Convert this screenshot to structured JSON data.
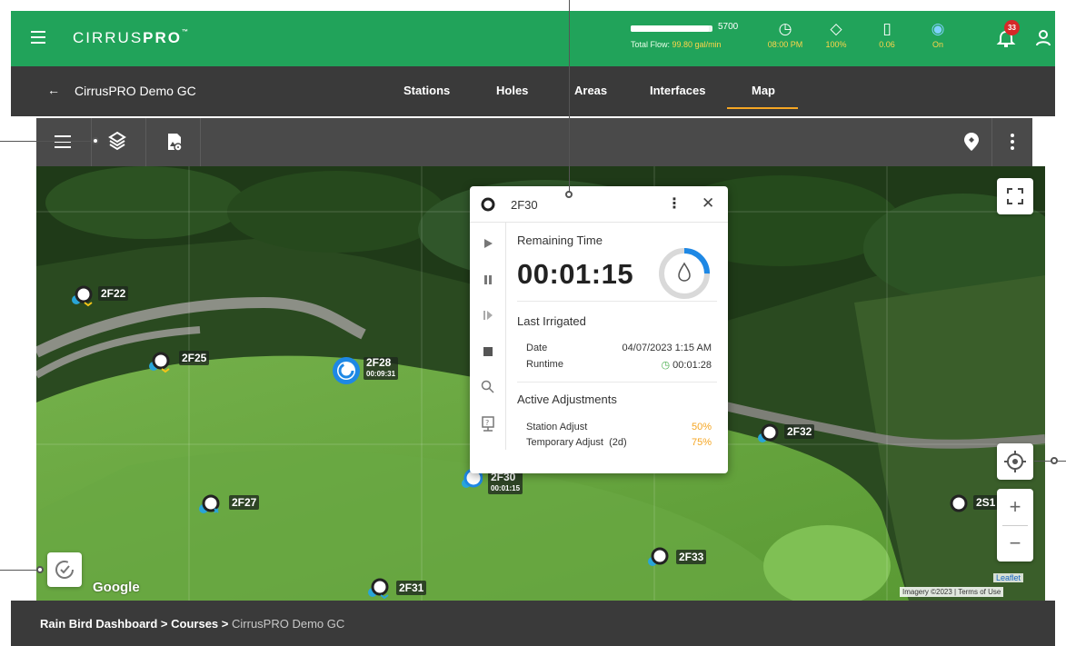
{
  "topbar": {
    "brand_main": "CIRRUS",
    "brand_bold": "PRO",
    "brand_tm": "™",
    "flow": {
      "max": "5700",
      "label": "Total Flow:",
      "value": "99.80 gal/min",
      "fill": 0.96
    },
    "stats": [
      {
        "icon": "clock-icon",
        "glyph": "◷",
        "value": "08:00 PM"
      },
      {
        "icon": "water-drop-icon",
        "glyph": "◇",
        "value": "100%"
      },
      {
        "icon": "gauge-icon",
        "glyph": "▯",
        "value": "0.06"
      },
      {
        "icon": "weather-sync-icon",
        "glyph": "◉",
        "value": "On"
      }
    ],
    "notification_count": "33"
  },
  "nav": {
    "back_glyph": "←",
    "title": "CirrusPRO Demo GC",
    "tabs": [
      "Stations",
      "Holes",
      "Areas",
      "Interfaces",
      "Map"
    ],
    "active_tab": "Map"
  },
  "map": {
    "markers": [
      {
        "name": "2F22",
        "sub": ""
      },
      {
        "name": "2F25",
        "sub": ""
      },
      {
        "name": "2F28",
        "sub": "00:09:31"
      },
      {
        "name": "2F32",
        "sub": ""
      },
      {
        "name": "2F27",
        "sub": ""
      },
      {
        "name": "2F30",
        "sub": "00:01:15"
      },
      {
        "name": "2S1",
        "sub": ""
      },
      {
        "name": "2F33",
        "sub": ""
      },
      {
        "name": "2F31",
        "sub": ""
      }
    ],
    "google": "Google",
    "attribution": "Imagery ©2023 | Terms of Use",
    "leaflet": "Leaflet",
    "zoom_in": "+",
    "zoom_out": "−"
  },
  "popup": {
    "station": "2F30",
    "menu_glyph": "⋮",
    "close_glyph": "✕",
    "remaining_label": "Remaining Time",
    "remaining_time": "00:01:15",
    "progress": 0.25,
    "last_irrigated_label": "Last Irrigated",
    "date_label": "Date",
    "date_value": "04/07/2023 1:15 AM",
    "runtime_label": "Runtime",
    "runtime_value": "00:01:28",
    "active_adjustments_label": "Active Adjustments",
    "station_adjust_label": "Station Adjust",
    "station_adjust_value": "50%",
    "temporary_adjust_label": "Temporary Adjust",
    "temporary_adjust_days": "(2d)",
    "temporary_adjust_value": "75%"
  },
  "footer": {
    "crumb_1": "Rain Bird Dashboard",
    "crumb_2": "Courses",
    "crumb_current": "CirrusPRO Demo GC",
    "separator": ">"
  },
  "colors": {
    "topbar": "#21a35a",
    "navbar": "#3a3a3a",
    "accent": "#f5a623",
    "running_blue": "#1e88e5"
  }
}
